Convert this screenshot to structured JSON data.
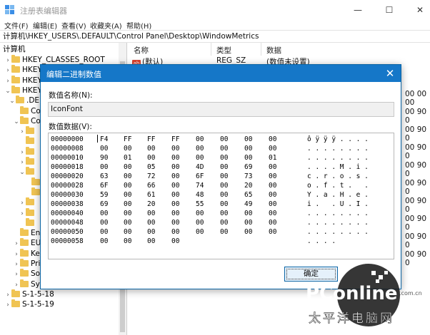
{
  "window": {
    "title": "注册表编辑器",
    "minimize": "—",
    "maximize": "☐",
    "close": "✕",
    "accent": "#1577c8"
  },
  "menu": [
    "文件(F)",
    "编辑(E)",
    "查看(V)",
    "收藏夹(A)",
    "帮助(H)"
  ],
  "address": "计算机\\HKEY_USERS\\.DEFAULT\\Control Panel\\Desktop\\WindowMetrics",
  "tree": {
    "root": "计算机",
    "items": [
      {
        "chev": "›",
        "label": "HKEY_CLASSES_ROOT"
      },
      {
        "chev": "›",
        "label": "HKEY_C"
      },
      {
        "chev": "›",
        "label": "HKEY_LO"
      },
      {
        "chev": "⌄",
        "label": "HKEY_U"
      },
      {
        "chev": "⌄",
        "label": ".DEFA"
      },
      {
        "chev": "",
        "label": "Co"
      },
      {
        "chev": "⌄",
        "label": "Co"
      },
      {
        "chev": "›",
        "label": ""
      },
      {
        "chev": "",
        "label": ""
      },
      {
        "chev": "›",
        "label": ""
      },
      {
        "chev": "›",
        "label": ""
      },
      {
        "chev": "⌄",
        "label": ""
      },
      {
        "chev": "",
        "label": ""
      },
      {
        "chev": "",
        "label": ""
      },
      {
        "chev": "›",
        "label": ""
      },
      {
        "chev": "›",
        "label": ""
      },
      {
        "chev": "",
        "label": ""
      },
      {
        "chev": "",
        "label": "Env"
      },
      {
        "chev": "›",
        "label": "EU"
      },
      {
        "chev": "›",
        "label": "Ke"
      },
      {
        "chev": "›",
        "label": "Pri"
      },
      {
        "chev": "›",
        "label": "So"
      },
      {
        "chev": "›",
        "label": "System"
      },
      {
        "chev": "›",
        "label": "S-1-5-18"
      },
      {
        "chev": "›",
        "label": "S-1-5-19"
      }
    ]
  },
  "list": {
    "columns": [
      "名称",
      "类型",
      "数据"
    ],
    "row": {
      "name": "(默认)",
      "type": "REG_SZ",
      "data": "(数值未设置)",
      "icon": "ab"
    },
    "side_values": [
      "00 00 00",
      "00 90 0",
      "00 90 0",
      "00 90 0",
      "00 90 0",
      "00 90 0",
      "00 90 0",
      "00 90 0",
      "00 90 0",
      "00 90 0"
    ]
  },
  "dialog": {
    "title": "编辑二进制数值",
    "close": "✕",
    "name_label": "数值名称(N):",
    "name_value": "IconFont",
    "data_label": "数值数据(V):",
    "ok": "确定",
    "rows": [
      {
        "addr": "00000000",
        "bytes": [
          "F4",
          "FF",
          "FF",
          "FF",
          "00",
          "00",
          "00",
          "00"
        ],
        "ascii": "ô ÿ ÿ ÿ . . . ."
      },
      {
        "addr": "00000008",
        "bytes": [
          "00",
          "00",
          "00",
          "00",
          "00",
          "00",
          "00",
          "00"
        ],
        "ascii": ". . . . . . . ."
      },
      {
        "addr": "00000010",
        "bytes": [
          "90",
          "01",
          "00",
          "00",
          "00",
          "00",
          "00",
          "01"
        ],
        "ascii": ". . . . . . . ."
      },
      {
        "addr": "00000018",
        "bytes": [
          "00",
          "00",
          "05",
          "00",
          "4D",
          "00",
          "69",
          "00"
        ],
        "ascii": ". . . . M . i ."
      },
      {
        "addr": "00000020",
        "bytes": [
          "63",
          "00",
          "72",
          "00",
          "6F",
          "00",
          "73",
          "00"
        ],
        "ascii": "c . r . o . s ."
      },
      {
        "addr": "00000028",
        "bytes": [
          "6F",
          "00",
          "66",
          "00",
          "74",
          "00",
          "20",
          "00"
        ],
        "ascii": "o . f . t .   ."
      },
      {
        "addr": "00000030",
        "bytes": [
          "59",
          "00",
          "61",
          "00",
          "48",
          "00",
          "65",
          "00"
        ],
        "ascii": "Y . a . H . e ."
      },
      {
        "addr": "00000038",
        "bytes": [
          "69",
          "00",
          "20",
          "00",
          "55",
          "00",
          "49",
          "00"
        ],
        "ascii": "i .   . U . I ."
      },
      {
        "addr": "00000040",
        "bytes": [
          "00",
          "00",
          "00",
          "00",
          "00",
          "00",
          "00",
          "00"
        ],
        "ascii": ". . . . . . . ."
      },
      {
        "addr": "00000048",
        "bytes": [
          "00",
          "00",
          "00",
          "00",
          "00",
          "00",
          "00",
          "00"
        ],
        "ascii": ". . . . . . . ."
      },
      {
        "addr": "00000050",
        "bytes": [
          "00",
          "00",
          "00",
          "00",
          "00",
          "00",
          "00",
          "00"
        ],
        "ascii": ". . . . . . . ."
      },
      {
        "addr": "00000058",
        "bytes": [
          "00",
          "00",
          "00",
          "00"
        ],
        "ascii": ". . . ."
      }
    ]
  },
  "watermark": {
    "brand": "PConline",
    "domain": ".com.cn",
    "tagline": "太平洋电脑网"
  }
}
